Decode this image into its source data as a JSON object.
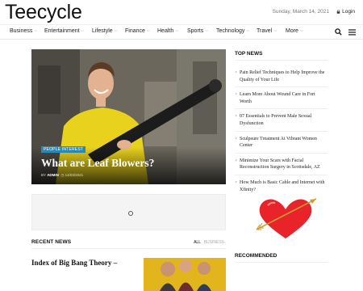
{
  "site": {
    "name": "Teecycle",
    "date": "Sunday, March 14, 2021",
    "login_label": "Login"
  },
  "nav": {
    "items": [
      {
        "label": "Business",
        "has_dropdown": true
      },
      {
        "label": "Entertainment",
        "has_dropdown": true
      },
      {
        "label": "Lifestyle",
        "has_dropdown": true
      },
      {
        "label": "Finance",
        "has_dropdown": true
      },
      {
        "label": "Health",
        "has_dropdown": true
      },
      {
        "label": "Sports",
        "has_dropdown": true
      },
      {
        "label": "Technology",
        "has_dropdown": true
      },
      {
        "label": "Travel",
        "has_dropdown": true
      },
      {
        "label": "More",
        "has_dropdown": true
      }
    ],
    "icons": [
      "search-icon",
      "hamburger-icon"
    ]
  },
  "featured": {
    "category": "PEOPLE INTEREST",
    "title": "What are Leaf Blowers?",
    "author_prefix": "BY",
    "author": "ADMIN",
    "date": "14/03/2021",
    "category_color": "#2a88b2"
  },
  "recent": {
    "heading": "RECENT NEWS",
    "tabs": [
      "ALL",
      "BUSINESS"
    ],
    "article_title": "Index of Big Bang Theory –"
  },
  "sidebar": {
    "top_news_heading": "TOP NEWS",
    "top_news": [
      "Pain Relief Techniques to Help Improve the Quality of Your Life",
      "Learn More About Wound Care in Fort Worth",
      "07 Essentials to Prevent Male Sexual Dysfunction",
      "Sculpsure Treatment At Vibrant Women Center",
      "Minimize Your Scars with Facial Reconstruction Surgery in Scottsdale, AZ",
      "How Much is Basic Cable and Internet with Xfinity?"
    ],
    "recommended_heading": "RECOMMENDED"
  },
  "colors": {
    "accent": "#2a88b2",
    "heart": "#e8232a"
  }
}
